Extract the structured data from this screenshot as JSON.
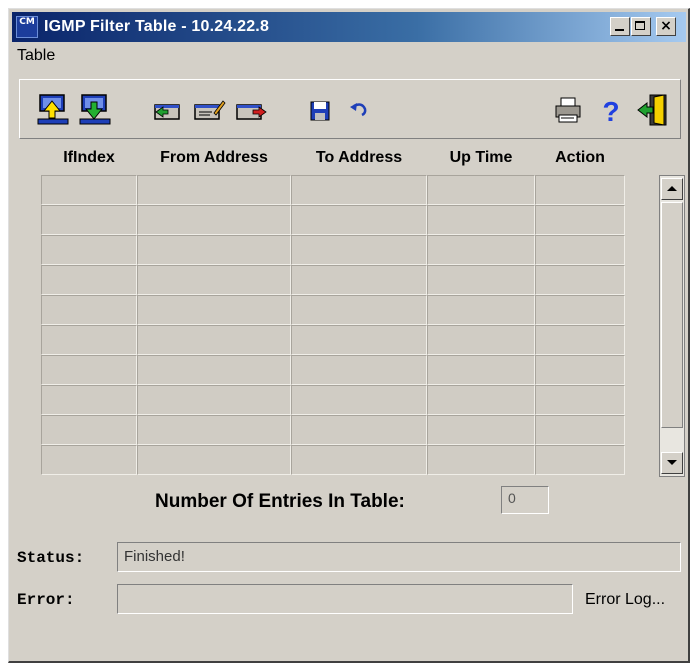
{
  "window": {
    "title": "IGMP Filter Table - 10.24.22.8",
    "app_icon_text": "CM",
    "controls": {
      "minimize": "minimize",
      "maximize": "maximize",
      "close": "×"
    }
  },
  "menu": {
    "items": [
      "Table"
    ]
  },
  "toolbar": {
    "buttons": [
      {
        "name": "upload-icon"
      },
      {
        "name": "download-icon"
      },
      {
        "name": "add-row-icon"
      },
      {
        "name": "edit-row-icon"
      },
      {
        "name": "delete-row-icon"
      },
      {
        "name": "save-icon"
      },
      {
        "name": "undo-icon"
      },
      {
        "name": "print-icon"
      },
      {
        "name": "help-icon"
      },
      {
        "name": "exit-icon"
      }
    ]
  },
  "table": {
    "columns": [
      "IfIndex",
      "From Address",
      "To Address",
      "Up Time",
      "Action"
    ],
    "empty_rows": 10,
    "rows": []
  },
  "entries": {
    "label": "Number Of Entries In Table:",
    "value": "0"
  },
  "status": {
    "label": "Status:",
    "value": "Finished!"
  },
  "error": {
    "label": "Error:",
    "value": "",
    "log_button": "Error Log..."
  },
  "colors": {
    "title_start": "#0a246a",
    "title_end": "#a6caf0",
    "face": "#d4d0c8",
    "accent_blue": "#2040c0"
  }
}
